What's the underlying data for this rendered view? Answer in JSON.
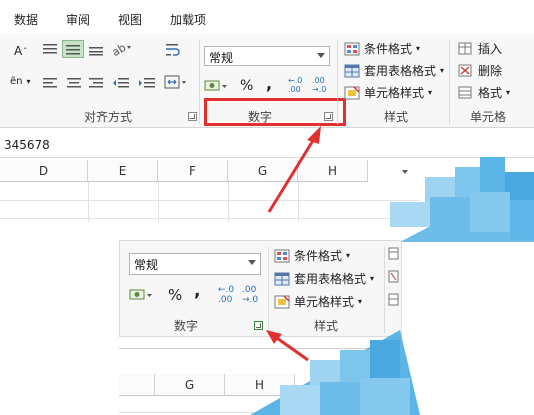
{
  "tabs": [
    "数据",
    "审阅",
    "视图",
    "加载项"
  ],
  "number_group": {
    "format_value": "常规",
    "percent": "%",
    "comma": ",",
    "inc_decimal": "←.0\n.00",
    "dec_decimal": ".00\n→.0",
    "label": "数字"
  },
  "alignment_group": {
    "label": "对齐方式"
  },
  "styles_group": {
    "conditional": "条件格式",
    "table_format": "套用表格格式",
    "cell_styles": "单元格样式",
    "label": "样式"
  },
  "cells_group": {
    "insert": "插入",
    "delete": "删除",
    "format": "格式",
    "label": "单元格"
  },
  "formula_bar": {
    "value": "345678"
  },
  "columns_top": [
    "D",
    "E",
    "F",
    "G",
    "H"
  ],
  "columns_bottom": [
    "G",
    "H"
  ],
  "colors": {
    "accent_red": "#e03030",
    "ribbon_bg": "#f7f7f7",
    "blur_blue": "#4aa8e0"
  }
}
